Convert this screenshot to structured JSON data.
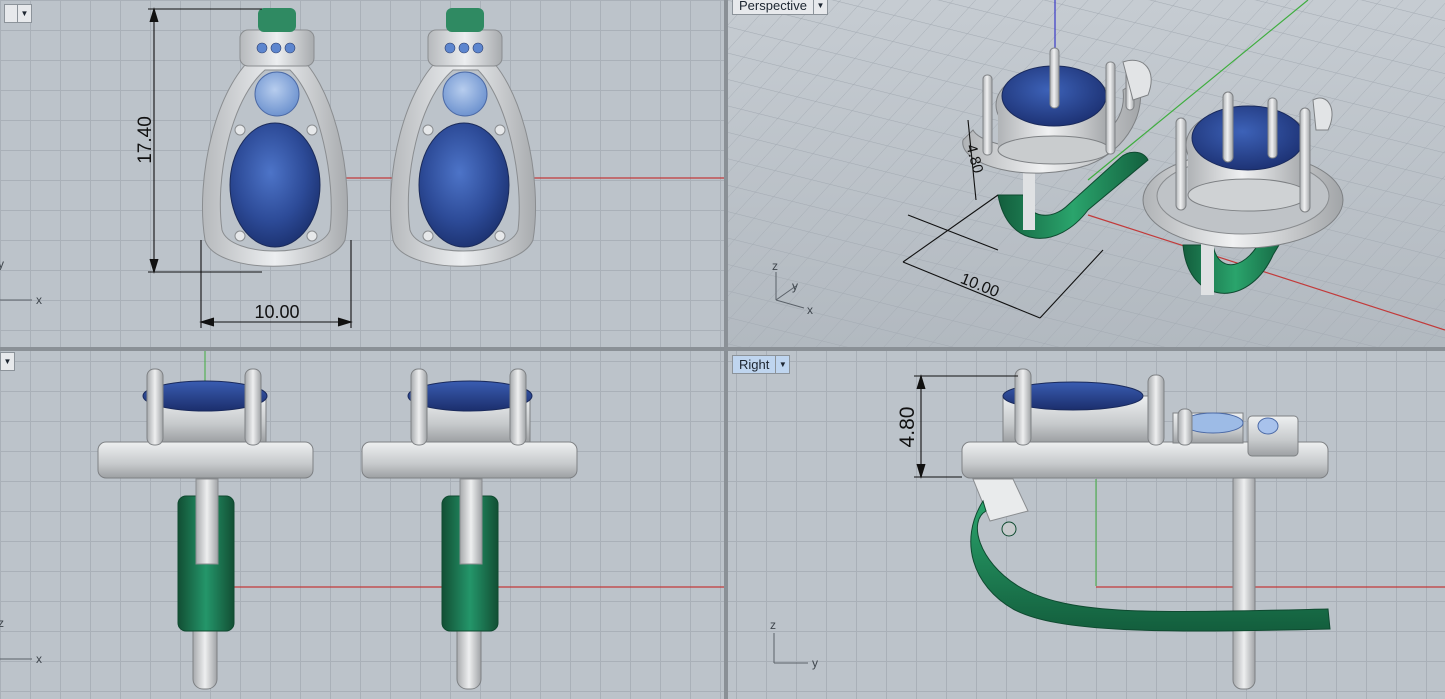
{
  "viewports": {
    "top": {
      "label": "",
      "dimension_height": "17.40",
      "dimension_width": "10.00",
      "axis_x": "x",
      "axis_y": "y"
    },
    "perspective": {
      "label": "Perspective",
      "dimension_height": "4.80",
      "dimension_width": "10.00",
      "axis_x": "x",
      "axis_y": "y",
      "axis_z": "z"
    },
    "front": {
      "label": "",
      "axis_x": "x",
      "axis_z": "z"
    },
    "right": {
      "label": "Right",
      "dimension_height": "4.80",
      "axis_y": "y",
      "axis_z": "z"
    }
  },
  "colors": {
    "viewport_bg": "#bcc3ca",
    "grid_line": "#a9b0b8",
    "metal": "#d6d8da",
    "gem_blue": "#2e4f9e",
    "gem_light": "#8fb0e0",
    "clasp_green": "#1f8a5a",
    "x_axis": "#c23a3a",
    "y_axis": "#3fae3f",
    "z_axis": "#3a3ac8",
    "active_label": "#bfd5ef"
  },
  "icons": [
    "viewport-dropdown-icon",
    "axis-widget-icon"
  ]
}
